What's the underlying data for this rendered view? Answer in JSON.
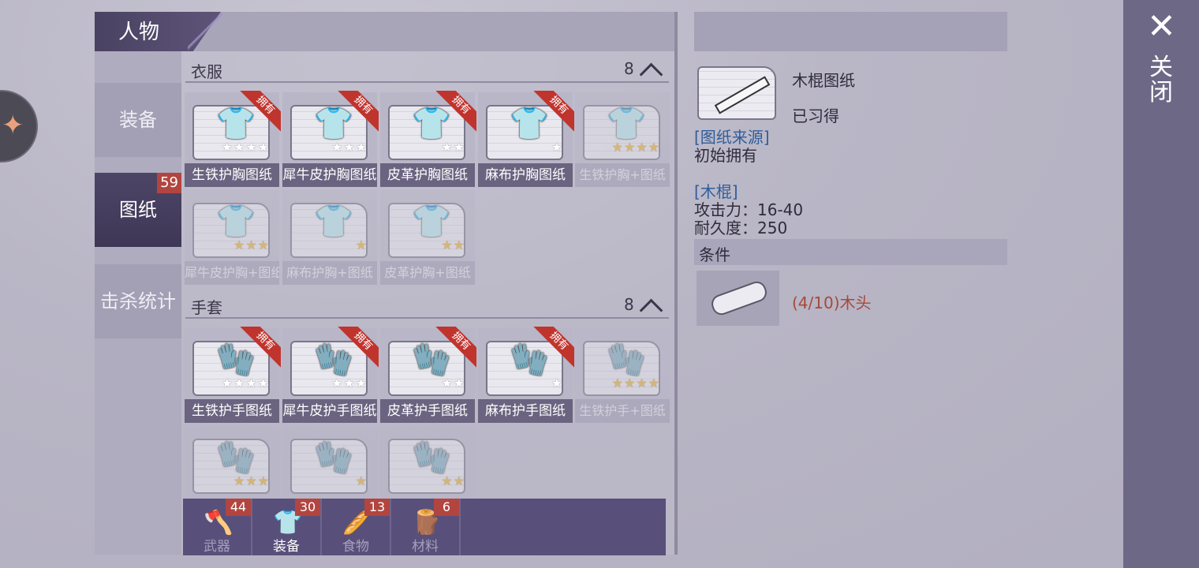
{
  "header": {
    "title": "人物"
  },
  "sidebar": {
    "items": [
      {
        "label": "装备",
        "badge": ""
      },
      {
        "label": "图纸",
        "badge": "59"
      },
      {
        "label": "击杀统计",
        "badge": ""
      }
    ]
  },
  "sections": [
    {
      "title": "衣服",
      "count": "8",
      "cards": [
        {
          "label": "生铁护胸图纸",
          "owned": "拥有",
          "stars": "★★★★",
          "star_color": "white",
          "icon": "chestplate-icon"
        },
        {
          "label": "犀牛皮护胸图纸",
          "owned": "拥有",
          "stars": "★★★",
          "star_color": "white",
          "icon": "chestplate-icon"
        },
        {
          "label": "皮革护胸图纸",
          "owned": "拥有",
          "stars": "★★",
          "star_color": "white",
          "icon": "chestplate-icon"
        },
        {
          "label": "麻布护胸图纸",
          "owned": "拥有",
          "stars": "★",
          "star_color": "white",
          "icon": "chestplate-icon"
        },
        {
          "label": "生铁护胸+图纸",
          "owned": "",
          "stars": "★★★★",
          "star_color": "gold",
          "icon": "chestplate-icon"
        },
        {
          "label": "犀牛皮护胸+图纸",
          "owned": "",
          "stars": "★★★",
          "star_color": "gold",
          "icon": "chestplate-icon"
        },
        {
          "label": "麻布护胸+图纸",
          "owned": "",
          "stars": "★",
          "star_color": "gold",
          "icon": "chestplate-icon"
        },
        {
          "label": "皮革护胸+图纸",
          "owned": "",
          "stars": "★★",
          "star_color": "gold",
          "icon": "chestplate-icon"
        }
      ]
    },
    {
      "title": "手套",
      "count": "8",
      "cards": [
        {
          "label": "生铁护手图纸",
          "owned": "拥有",
          "stars": "★★★★",
          "star_color": "white",
          "icon": "glove-icon"
        },
        {
          "label": "犀牛皮护手图纸",
          "owned": "拥有",
          "stars": "★★★",
          "star_color": "white",
          "icon": "glove-icon"
        },
        {
          "label": "皮革护手图纸",
          "owned": "拥有",
          "stars": "★★",
          "star_color": "white",
          "icon": "glove-icon"
        },
        {
          "label": "麻布护手图纸",
          "owned": "拥有",
          "stars": "★",
          "star_color": "white",
          "icon": "glove-icon"
        },
        {
          "label": "生铁护手+图纸",
          "owned": "",
          "stars": "★★★★",
          "star_color": "gold",
          "icon": "glove-icon"
        },
        {
          "label": "",
          "owned": "",
          "stars": "★★★",
          "star_color": "gold",
          "icon": "glove-icon"
        },
        {
          "label": "",
          "owned": "",
          "stars": "★",
          "star_color": "gold",
          "icon": "glove-icon"
        },
        {
          "label": "",
          "owned": "",
          "stars": "★★",
          "star_color": "gold",
          "icon": "glove-icon"
        }
      ]
    }
  ],
  "categories": [
    {
      "label": "武器",
      "badge": "44",
      "icon": "axe-icon"
    },
    {
      "label": "装备",
      "badge": "30",
      "icon": "shirt-icon"
    },
    {
      "label": "食物",
      "badge": "13",
      "icon": "food-icon"
    },
    {
      "label": "材料",
      "badge": "6",
      "icon": "material-icon"
    }
  ],
  "detail": {
    "name": "木棍图纸",
    "status": "已习得",
    "source_header": "[图纸来源]",
    "source_value": "初始拥有",
    "item_header": "[木棍]",
    "attack": "攻击力：16-40",
    "durability": "耐久度：250",
    "condition_header": "条件",
    "condition_text": "(4/10)木头"
  },
  "close": {
    "label": "关闭"
  }
}
